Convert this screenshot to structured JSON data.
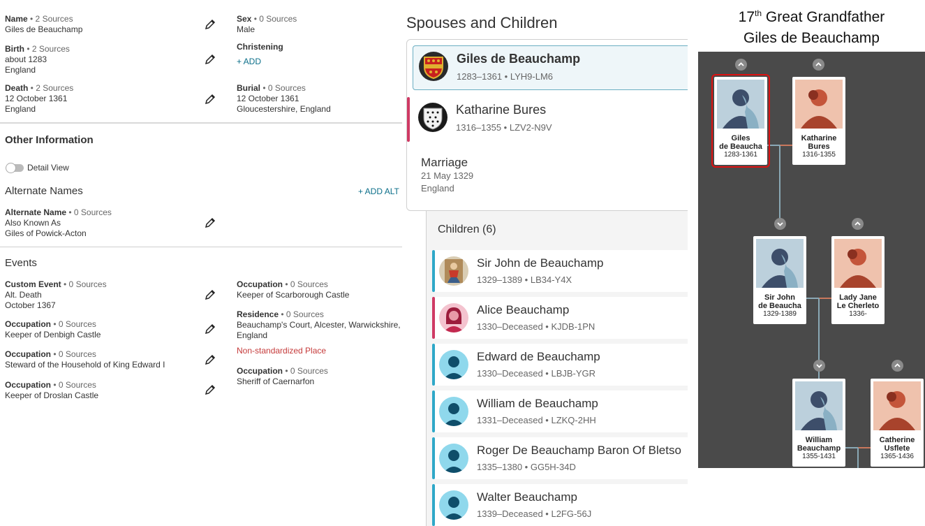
{
  "vitals": {
    "name": {
      "label": "Name",
      "sources": " • 2 Sources",
      "value": "Giles de Beauchamp"
    },
    "sex": {
      "label": "Sex",
      "sources": " • 0 Sources",
      "value": "Male"
    },
    "birth": {
      "label": "Birth",
      "sources": " • 2 Sources",
      "value1": "about 1283",
      "value2": "England"
    },
    "christening": {
      "label": "Christening",
      "add": "+  ADD"
    },
    "death": {
      "label": "Death",
      "sources": " • 2 Sources",
      "value1": "12 October 1361",
      "value2": "England"
    },
    "burial": {
      "label": "Burial",
      "sources": " • 0 Sources",
      "value1": "12 October 1361",
      "value2": "Gloucestershire, England"
    }
  },
  "other_info": {
    "title": "Other Information",
    "detail_view": "Detail View",
    "alt_names_title": "Alternate Names",
    "add_alt": "+  ADD ALT",
    "alt_name": {
      "label": "Alternate Name",
      "sources": " • 0 Sources",
      "value1": "Also Known As",
      "value2": "Giles of Powick-Acton"
    }
  },
  "events": {
    "title": "Events",
    "left": [
      {
        "label": "Custom Event",
        "sources": " • 0 Sources",
        "value1": "Alt. Death",
        "value2": "October 1367"
      },
      {
        "label": "Occupation",
        "sources": " • 0 Sources",
        "value1": "Keeper of Denbigh Castle",
        "value2": ""
      },
      {
        "label": "Occupation",
        "sources": " • 0 Sources",
        "value1": "Steward of the Household of King Edward I",
        "value2": ""
      },
      {
        "label": "Occupation",
        "sources": " • 0 Sources",
        "value1": "Keeper of Droslan Castle",
        "value2": ""
      }
    ],
    "right": [
      {
        "label": "Occupation",
        "sources": " • 0 Sources",
        "value1": "Keeper of Scarborough Castle",
        "value2": ""
      },
      {
        "label": "Residence",
        "sources": " • 0 Sources",
        "value1": "Beauchamp's Court, Alcester, Warwickshire,",
        "value2": "England"
      },
      {
        "label": "Occupation",
        "sources": " • 0 Sources",
        "value1": "Sheriff of Caernarfon",
        "value2": ""
      }
    ],
    "non_standard": "Non-standardized Place"
  },
  "spouses": {
    "title": "Spouses and Children",
    "husband": {
      "name": "Giles de Beauchamp",
      "sub": "1283–1361 • LYH9-LM6"
    },
    "wife": {
      "name": "Katharine Bures",
      "sub": "1316–1355 • LZV2-N9V"
    },
    "marriage": {
      "title": "Marriage",
      "date": "21 May 1329",
      "place": "England"
    }
  },
  "children": {
    "title": "Children (6)",
    "items": [
      {
        "name": "Sir John de Beauchamp",
        "sub": "1329–1389 • LB34-Y4X",
        "gender": "male-portrait"
      },
      {
        "name": "Alice Beauchamp",
        "sub": "1330–Deceased • KJDB-1PN",
        "gender": "female"
      },
      {
        "name": "Edward de Beauchamp",
        "sub": "1330–Deceased • LBJB-YGR",
        "gender": "male"
      },
      {
        "name": "William de Beauchamp",
        "sub": "1331–Deceased • LZKQ-2HH",
        "gender": "male"
      },
      {
        "name": "Roger De Beauchamp Baron Of Bletso",
        "sub": "1335–1380 • GG5H-34D",
        "gender": "male"
      },
      {
        "name": "Walter Beauchamp",
        "sub": "1339–Deceased • L2FG-56J",
        "gender": "male"
      }
    ]
  },
  "tree": {
    "title_pre": "17",
    "title_sup": "th",
    "title_post": " Great Grandfather",
    "subtitle": "Giles de Beauchamp",
    "people": [
      {
        "name1": "Giles",
        "name2": "de Beaucha",
        "years": "1283-1361",
        "gender": "male"
      },
      {
        "name1": "Katharine",
        "name2": "Bures",
        "years": "1316-1355",
        "gender": "female"
      },
      {
        "name1": "Sir John",
        "name2": "de Beaucha",
        "years": "1329-1389",
        "gender": "male"
      },
      {
        "name1": "Lady Jane",
        "name2": "Le Cherleto",
        "years": "1336-",
        "gender": "female"
      },
      {
        "name1": "William",
        "name2": "Beauchamp",
        "years": "1355-1431",
        "gender": "male"
      },
      {
        "name1": "Catherine",
        "name2": "Usflete",
        "years": "1365-1436",
        "gender": "female"
      }
    ]
  },
  "colors": {
    "accent": "#0c6f8a",
    "female_bar": "#cf3a64",
    "male_bar": "#2fa8c8",
    "error": "#c53a3a",
    "tree_bg": "#4a4a4a"
  }
}
